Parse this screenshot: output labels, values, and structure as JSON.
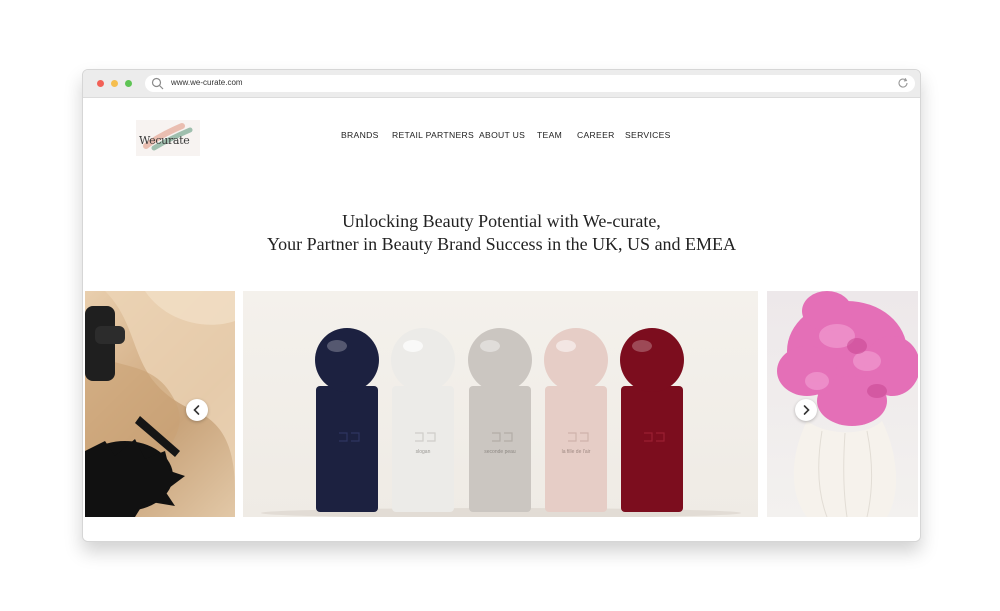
{
  "browser": {
    "url": "www.we-curate.com"
  },
  "site": {
    "logo_text": "Wecurate",
    "nav": [
      "BRANDS",
      "RETAIL PARTNERS",
      "ABOUT US",
      "TEAM",
      "CAREER",
      "SERVICES"
    ]
  },
  "hero": {
    "line1": "Unlocking Beauty Potential with We-curate,",
    "line2": "Your Partner in Beauty Brand Success in the UK, US and EMEA"
  },
  "carousel": {
    "bottle_labels": [
      "",
      "slogan",
      "seconde peau",
      "la fille de l'air",
      ""
    ]
  },
  "icons": {
    "search": "search-icon",
    "reload": "reload-icon",
    "prev": "chevron-left-icon",
    "next": "chevron-right-icon"
  },
  "colors": {
    "bottle_navy": "#1c2140",
    "bottle_white": "#ecebe8",
    "bottle_grey": "#cbc6c1",
    "bottle_pink": "#e6cdc6",
    "bottle_red": "#7c0d1e",
    "peony": "#e46fb7"
  }
}
